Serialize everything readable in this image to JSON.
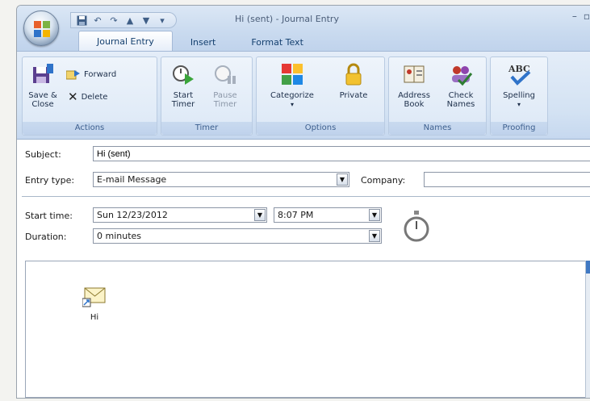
{
  "window": {
    "title": "Hi (sent) - Journal Entry",
    "controls": [
      "–",
      "▫"
    ]
  },
  "quick_access": [
    "save-icon",
    "undo-icon",
    "redo-icon",
    "up-arrow-icon",
    "down-arrow-icon",
    "customize-icon"
  ],
  "tabs": [
    {
      "label": "Journal Entry",
      "active": true
    },
    {
      "label": "Insert",
      "active": false
    },
    {
      "label": "Format Text",
      "active": false
    }
  ],
  "ribbon": {
    "actions": {
      "label": "Actions",
      "save_close": "Save & Close",
      "forward": "Forward",
      "delete": "Delete"
    },
    "timer": {
      "label": "Timer",
      "start": "Start Timer",
      "pause": "Pause Timer"
    },
    "options": {
      "label": "Options",
      "categorize": "Categorize",
      "private": "Private"
    },
    "names": {
      "label": "Names",
      "address_book": "Address Book",
      "check_names": "Check Names"
    },
    "proofing": {
      "label": "Proofing",
      "spelling": "Spelling"
    }
  },
  "form": {
    "subject_label": "Subject:",
    "subject_value": "Hi (sent)",
    "entry_type_label": "Entry type:",
    "entry_type_value": "E-mail Message",
    "company_label": "Company:",
    "company_value": "",
    "start_time_label": "Start time:",
    "start_date_value": "Sun 12/23/2012",
    "start_time_value": "8:07 PM",
    "duration_label": "Duration:",
    "duration_value": "0 minutes"
  },
  "attachment": {
    "icon": "envelope-icon",
    "label": "Hi"
  },
  "colors": {
    "ribbon_bg": "#d3e2f3",
    "accent": "#3f78c3",
    "titlebar": "#c9daef"
  }
}
